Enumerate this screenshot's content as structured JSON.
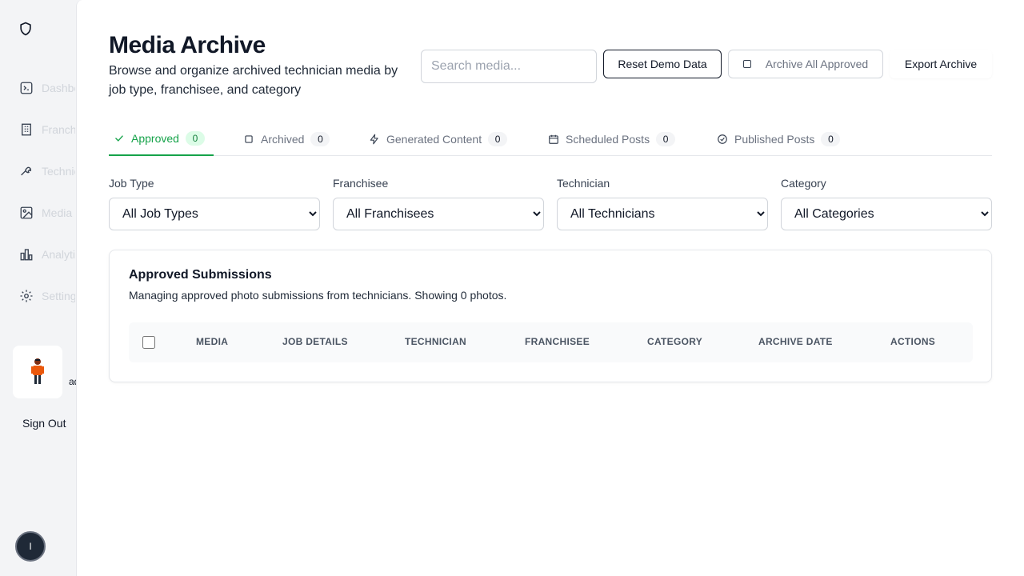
{
  "sidebar": {
    "logo": "shield-icon",
    "items": [
      {
        "label": "Dashboard",
        "icon": "terminal-icon"
      },
      {
        "label": "Franchisees",
        "icon": "building-icon"
      },
      {
        "label": "Technicians",
        "icon": "wrench-icon"
      },
      {
        "label": "Media",
        "icon": "image-icon"
      },
      {
        "label": "Analytics",
        "icon": "bar-chart-icon"
      },
      {
        "label": "Settings",
        "icon": "gear-icon"
      }
    ],
    "user_tail": "ad",
    "sign_out": "Sign Out",
    "badge": "I"
  },
  "header": {
    "title": "Media Archive",
    "subtitle": "Browse and organize archived technician media by job type, franchisee, and category"
  },
  "toolbar": {
    "search_placeholder": "Search media...",
    "reset_label": "Reset Demo Data",
    "archive_all_label": "Archive All Approved",
    "export_label": "Export Archive"
  },
  "tabs": [
    {
      "label": "Approved",
      "count": "0",
      "icon": "check-icon"
    },
    {
      "label": "Archived",
      "count": "0",
      "icon": "square-icon"
    },
    {
      "label": "Generated Content",
      "count": "0",
      "icon": "lightning-icon"
    },
    {
      "label": "Scheduled Posts",
      "count": "0",
      "icon": "calendar-icon"
    },
    {
      "label": "Published Posts",
      "count": "0",
      "icon": "check-circle-icon"
    }
  ],
  "filters": [
    {
      "label": "Job Type",
      "value": "All Job Types"
    },
    {
      "label": "Franchisee",
      "value": "All Franchisees"
    },
    {
      "label": "Technician",
      "value": "All Technicians"
    },
    {
      "label": "Category",
      "value": "All Categories"
    }
  ],
  "card": {
    "title": "Approved Submissions",
    "description": "Managing approved photo submissions from technicians. Showing 0 photos.",
    "columns": [
      "MEDIA",
      "JOB DETAILS",
      "TECHNICIAN",
      "FRANCHISEE",
      "CATEGORY",
      "ARCHIVE DATE",
      "ACTIONS"
    ]
  },
  "colors": {
    "accent": "#16a34a",
    "accent_bg": "#dcfce7",
    "sidebar_bg": "#f3f4f6"
  }
}
